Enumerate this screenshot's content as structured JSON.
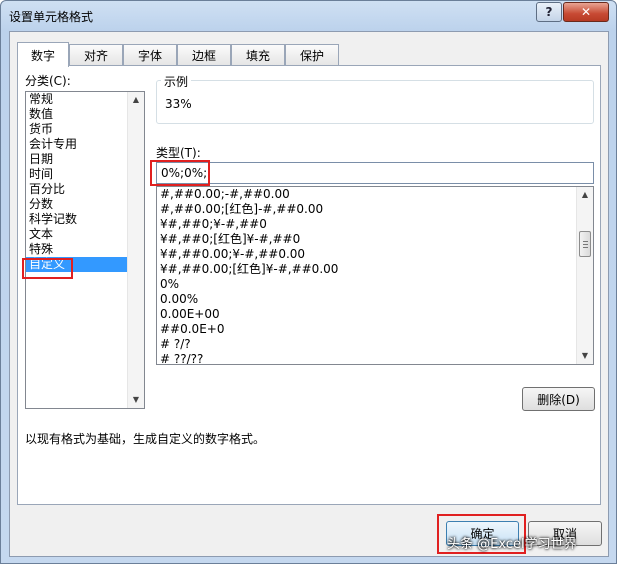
{
  "window": {
    "title": "设置单元格格式",
    "help_label": "?",
    "close_label": "✕"
  },
  "tabs": [
    {
      "label": "数字",
      "active": true
    },
    {
      "label": "对齐"
    },
    {
      "label": "字体"
    },
    {
      "label": "边框"
    },
    {
      "label": "填充"
    },
    {
      "label": "保护"
    }
  ],
  "category": {
    "label": "分类(C):",
    "items": [
      "常规",
      "数值",
      "货币",
      "会计专用",
      "日期",
      "时间",
      "百分比",
      "分数",
      "科学记数",
      "文本",
      "特殊",
      "自定义"
    ],
    "selected": "自定义"
  },
  "sample": {
    "legend": "示例",
    "value": "33%"
  },
  "type": {
    "label": "类型(T):",
    "value": "0%;0%;"
  },
  "format_list": [
    "#,##0.00;-#,##0.00",
    "#,##0.00;[红色]-#,##0.00",
    "¥#,##0;¥-#,##0",
    "¥#,##0;[红色]¥-#,##0",
    "¥#,##0.00;¥-#,##0.00",
    "¥#,##0.00;[红色]¥-#,##0.00",
    "0%",
    "0.00%",
    "0.00E+00",
    "##0.0E+0",
    "# ?/?",
    "# ??/??"
  ],
  "delete_button": "删除(D)",
  "description": "以现有格式为基础，生成自定义的数字格式。",
  "footer": {
    "ok_label": "确定",
    "cancel_label": "取消"
  },
  "watermark": "头条 @Excel学习世界",
  "colors": {
    "selection": "#3399ff",
    "highlight_box": "#e02020"
  }
}
